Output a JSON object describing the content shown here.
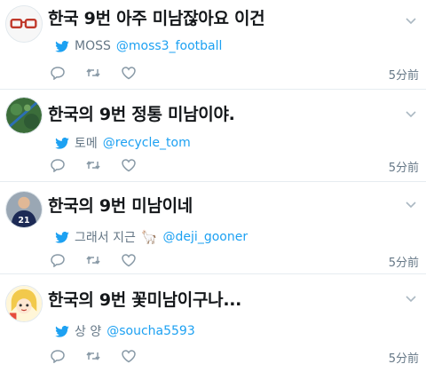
{
  "tweets": [
    {
      "text": "한국 9번 아주 미남잖아요 이건",
      "source_name": "MOSS",
      "source_handle": "@moss3_football",
      "time": "5分前"
    },
    {
      "text": "한국의 9번 정통 미남이야.",
      "source_name": "토메",
      "source_handle": "@recycle_tom",
      "time": "5分前"
    },
    {
      "text": "한국의 9번 미남이네",
      "source_name": "그래서 지근",
      "source_emoji": "🦙",
      "source_handle": "@deji_gooner",
      "time": "5分前",
      "avatar_number": "21"
    },
    {
      "text": "한국의 9번 꽃미남이구나...",
      "source_name": "상 양",
      "source_handle": "@soucha5593",
      "time": "5分前"
    }
  ],
  "icons": {
    "source": "twitter-bird-icon",
    "reply": "reply-icon",
    "retweet": "retweet-icon",
    "like": "heart-icon",
    "menu": "chevron-down-icon"
  },
  "colors": {
    "twitter_blue": "#1da1f2",
    "gray_text": "#657786",
    "icon_gray": "#8899a6",
    "divider": "#e6ecf0"
  }
}
